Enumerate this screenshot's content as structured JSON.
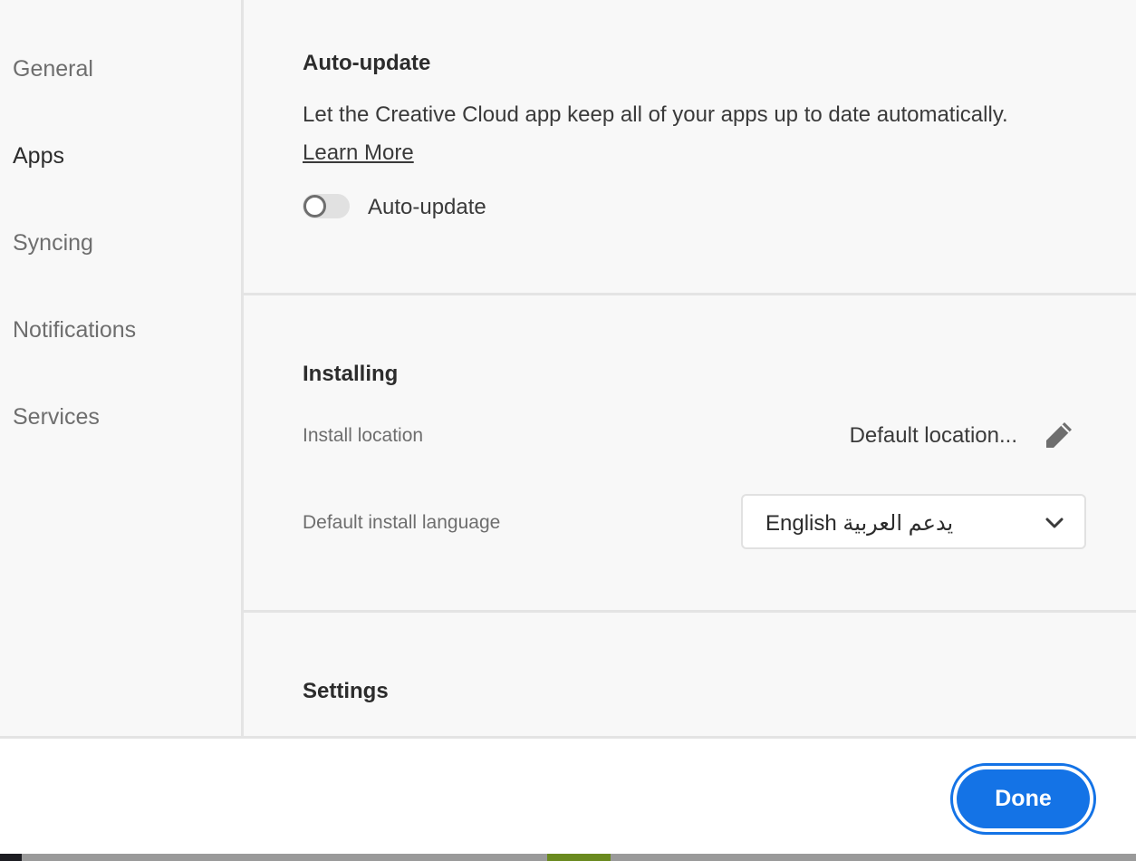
{
  "sidebar": {
    "items": [
      {
        "label": "General",
        "active": false
      },
      {
        "label": "Apps",
        "active": true
      },
      {
        "label": "Syncing",
        "active": false
      },
      {
        "label": "Notifications",
        "active": false
      },
      {
        "label": "Services",
        "active": false
      }
    ]
  },
  "auto_update": {
    "heading": "Auto-update",
    "description": "Let the Creative Cloud app keep all of your apps up to date automatically.",
    "learn_more": "Learn More",
    "toggle_label": "Auto-update",
    "toggle_on": false
  },
  "installing": {
    "heading": "Installing",
    "location_label": "Install location",
    "location_value": "Default location...",
    "language_label": "Default install language",
    "language_value": "English يدعم العربية"
  },
  "settings": {
    "heading": "Settings"
  },
  "footer": {
    "done_label": "Done"
  },
  "colors": {
    "accent": "#1473e6",
    "panel_bg": "#f8f8f8",
    "divider": "#e4e4e4"
  },
  "icons": {
    "edit": "pencil-icon",
    "dropdown": "chevron-down-icon"
  }
}
